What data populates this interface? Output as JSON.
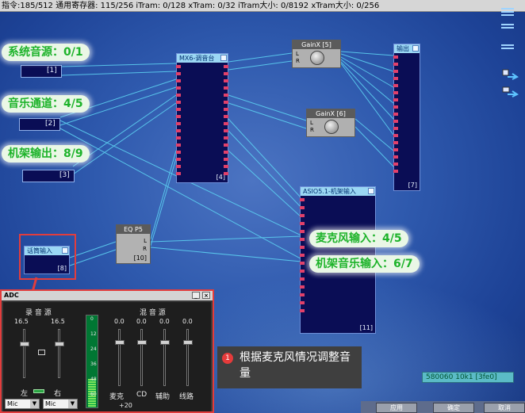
{
  "status_bar": "指令:185/512 通用寄存器: 115/256 iTram: 0/128 xTram: 0/32 iTram大小: 0/8192 xTram大小: 0/256",
  "sources": [
    {
      "label": "系统音源：0/1",
      "index": "[1]"
    },
    {
      "label": "音乐通道：4/5",
      "index": "[2]"
    },
    {
      "label": "机架输出：8/9",
      "index": "[3]"
    }
  ],
  "mx6": {
    "title": "MX6-调音台",
    "index": "[4]"
  },
  "gain5": {
    "title": "GainX [5]",
    "l": "L",
    "r": "R"
  },
  "gain6": {
    "title": "GainX [6]",
    "l": "L",
    "r": "R"
  },
  "output": {
    "title": "输出",
    "index": "[7]"
  },
  "mic_in": {
    "title": "话筒输入",
    "index": "[8]"
  },
  "eq": {
    "title": "EQ P5",
    "l": "L",
    "r": "R",
    "index": "[10]"
  },
  "asio": {
    "title": "ASIO5.1-机架输入",
    "index": "[11]",
    "labels": [
      "麦克风输入：4/5",
      "机架音乐输入：6/7"
    ]
  },
  "adc": {
    "title": "ADC",
    "rec_label": "录 音 源",
    "mix_label": "混 音 源",
    "rec_values": [
      "16.5",
      "16.5"
    ],
    "rec_channels": [
      "左",
      "右"
    ],
    "mix_values": [
      "0.0",
      "0.0",
      "0.0",
      "0.0"
    ],
    "mix_channels": [
      "麦克",
      "CD",
      "辅助",
      "线路"
    ],
    "meter_ticks": [
      "0",
      "12",
      "24",
      "36",
      "48",
      "60"
    ],
    "selects": [
      "Mic",
      "Mic"
    ],
    "boost": "+20"
  },
  "tooltip": {
    "number": "1",
    "text": "根据麦克风情况调整音量"
  },
  "address_readout": "580060 10k1 [3fe0]",
  "buttons": [
    "应用",
    "确定",
    "取消"
  ],
  "colors": {
    "label_green": "#1db32a",
    "highlight": "#e23d3d",
    "block_fill": "#0a0d55"
  }
}
